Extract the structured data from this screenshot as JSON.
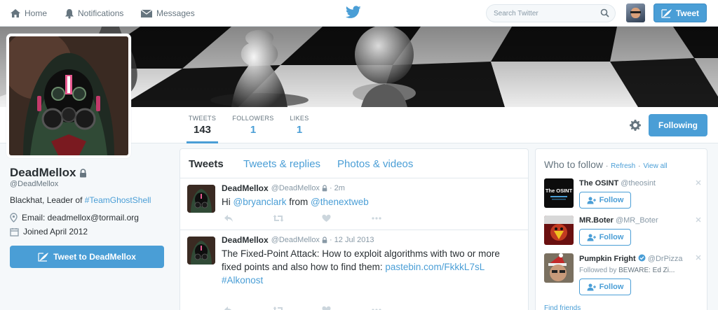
{
  "nav": {
    "home": "Home",
    "notifications": "Notifications",
    "messages": "Messages",
    "search_placeholder": "Search Twitter",
    "tweet_button": "Tweet"
  },
  "profile": {
    "name": "DeadMellox",
    "handle": "@DeadMellox",
    "bio_prefix": "Blackhat, Leader of ",
    "bio_hashtag": "#TeamGhostShell",
    "email": "Email: deadmellox@tormail.org",
    "joined": "Joined April 2012",
    "tweet_to_button": "Tweet to DeadMellox"
  },
  "stats": {
    "tweets_label": "TWEETS",
    "tweets_value": "143",
    "followers_label": "FOLLOWERS",
    "followers_value": "1",
    "likes_label": "LIKES",
    "likes_value": "1",
    "following_button": "Following"
  },
  "timeline": {
    "tabs": [
      "Tweets",
      "Tweets & replies",
      "Photos & videos"
    ],
    "tweets": [
      {
        "name": "DeadMellox",
        "handle": "@DeadMellox",
        "time": "2m",
        "text_1": "Hi ",
        "mention_1": "@bryanclark",
        "text_2": " from ",
        "mention_2": "@thenextweb"
      },
      {
        "name": "DeadMellox",
        "handle": "@DeadMellox",
        "time": "12 Jul 2013",
        "text": "The Fixed-Point Attack: How to exploit algorithms with two or more fixed points and also how to find them: ",
        "link": "pastebin.com/FkkkL7sL",
        "hashtag": "#Alkonost"
      }
    ]
  },
  "who_to_follow": {
    "title": "Who to follow",
    "refresh": "Refresh",
    "view_all": "View all",
    "follow_label": "Follow",
    "find_friends": "Find friends",
    "suggestions": [
      {
        "name": "The OSINT",
        "handle": "@theosint",
        "avatar_text": "The OSINT"
      },
      {
        "name": "MR.Boter",
        "handle": "@MR_Boter"
      },
      {
        "name": "Pumpkin Fright",
        "handle": "@DrPizza",
        "followed_by_prefix": "Followed by ",
        "followed_by": "BEWARE: Ed Zi..."
      }
    ]
  },
  "colors": {
    "accent": "#4a9ed6",
    "text": "#292f33",
    "muted": "#66757f",
    "background": "#f5f8fa"
  }
}
